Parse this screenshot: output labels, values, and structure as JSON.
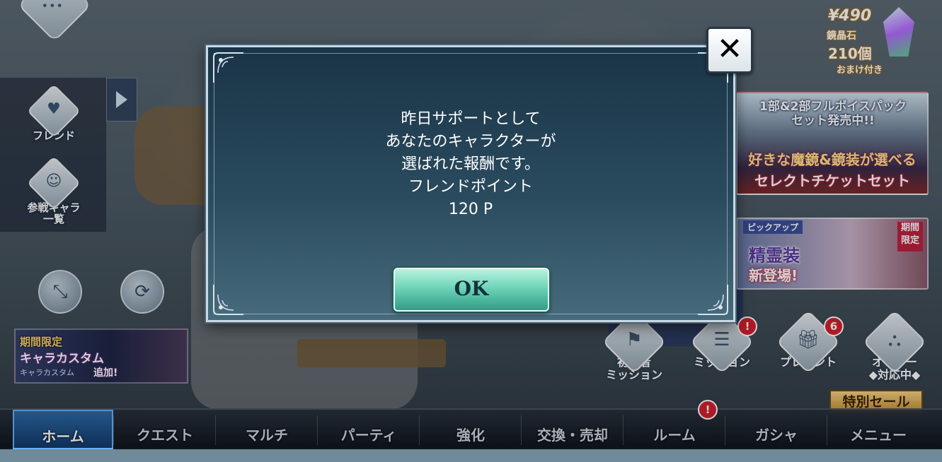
{
  "left_panel": {
    "friend_label": "フレンド",
    "characters_label": "参戦キャラ\n一覧"
  },
  "left_banner": {
    "line1": "期間限定",
    "line2": "キャラカスタム",
    "line3": "キャラカスタム",
    "line4": "追加!"
  },
  "promo_gem": {
    "price": "¥490",
    "line2": "鏡晶石",
    "line3": "210個",
    "line4": "おまけ付き"
  },
  "banner_voice": {
    "line1": "1部&2部フルボイスパック",
    "line2": "セット発売中!!",
    "line3": "好きな魔鏡&鏡装が選べる",
    "line4": "セレクトチケットセット"
  },
  "banner_pickup": {
    "tag": "ピックアップ",
    "title": "精霊装",
    "subtitle": "新登場!",
    "limited": "期間\n限定"
  },
  "action_buttons": [
    {
      "label": "初心者\nミッション"
    },
    {
      "label": "ミッション",
      "badge": "!"
    },
    {
      "label": "プレゼント",
      "badge": "6"
    },
    {
      "label": "オーダー\n◆対応中◆"
    }
  ],
  "sale_label": "特別セール",
  "nav": {
    "items": [
      {
        "label": "ホーム"
      },
      {
        "label": "クエスト"
      },
      {
        "label": "マルチ"
      },
      {
        "label": "パーティ"
      },
      {
        "label": "強化"
      },
      {
        "label": "交換・売却"
      },
      {
        "label": "ルーム",
        "badge": "!"
      },
      {
        "label": "ガシャ"
      },
      {
        "label": "メニュー"
      }
    ],
    "active_index": 0
  },
  "modal": {
    "message_lines": [
      "昨日サポートとして",
      "あなたのキャラクターが",
      "選ばれた報酬です。",
      "フレンドポイント",
      "120 P"
    ],
    "ok_label": "OK",
    "close_label": "✕"
  },
  "colors": {
    "modal_bg": "#1a3447",
    "ok_button": "#6fd4b8",
    "badge_red": "#d4202e"
  }
}
